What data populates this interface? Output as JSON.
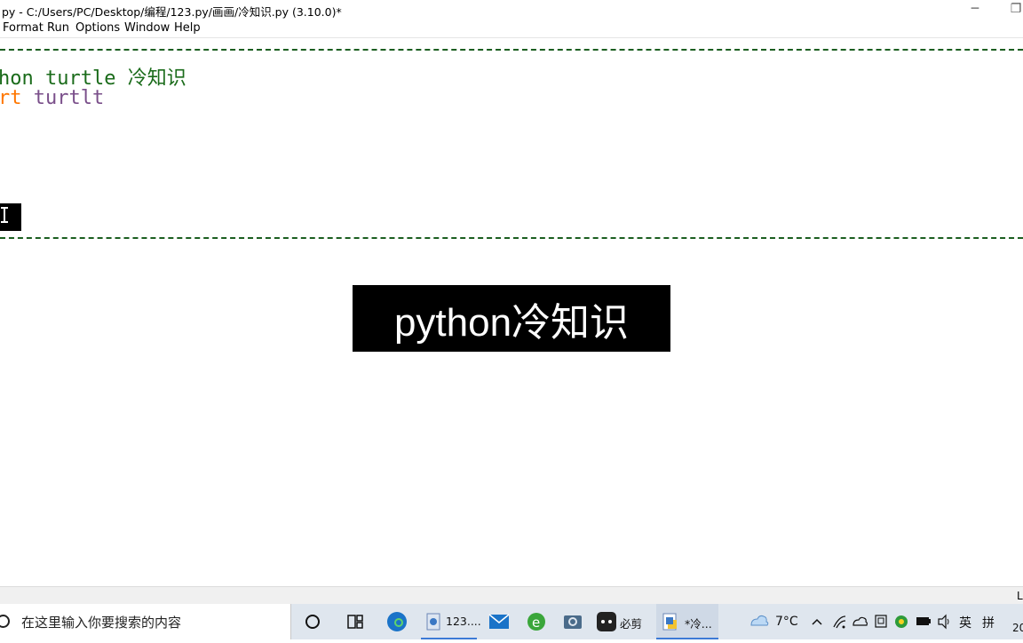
{
  "window": {
    "title": "py - C:/Users/PC/Desktop/编程/123.py/画画/冷知识.py (3.10.0)*",
    "minimize_glyph": "─",
    "restore_glyph": "❐"
  },
  "menu": {
    "format": "Format",
    "run": "Run",
    "options": "Options",
    "window": "Window",
    "help": "Help"
  },
  "editor": {
    "line1": "hon turtle 冷知识",
    "line2_kw": "rt",
    "line2_name": " turtlt",
    "banner": "python冷知识"
  },
  "status": {
    "line_indicator": "L"
  },
  "taskbar": {
    "search_placeholder": "在这里输入你要搜索的内容",
    "app_123": "123....",
    "app_bijian": "必剪",
    "app_idle": "*冷...",
    "weather": "7°C",
    "ime_lang": "英",
    "ime_mode": "拼",
    "clock_partial": "20",
    "colors": {
      "accent": "#3c7ad6",
      "comment": "#1a6b1a",
      "keyword": "#ff7700",
      "name": "#7a4f8a"
    }
  }
}
